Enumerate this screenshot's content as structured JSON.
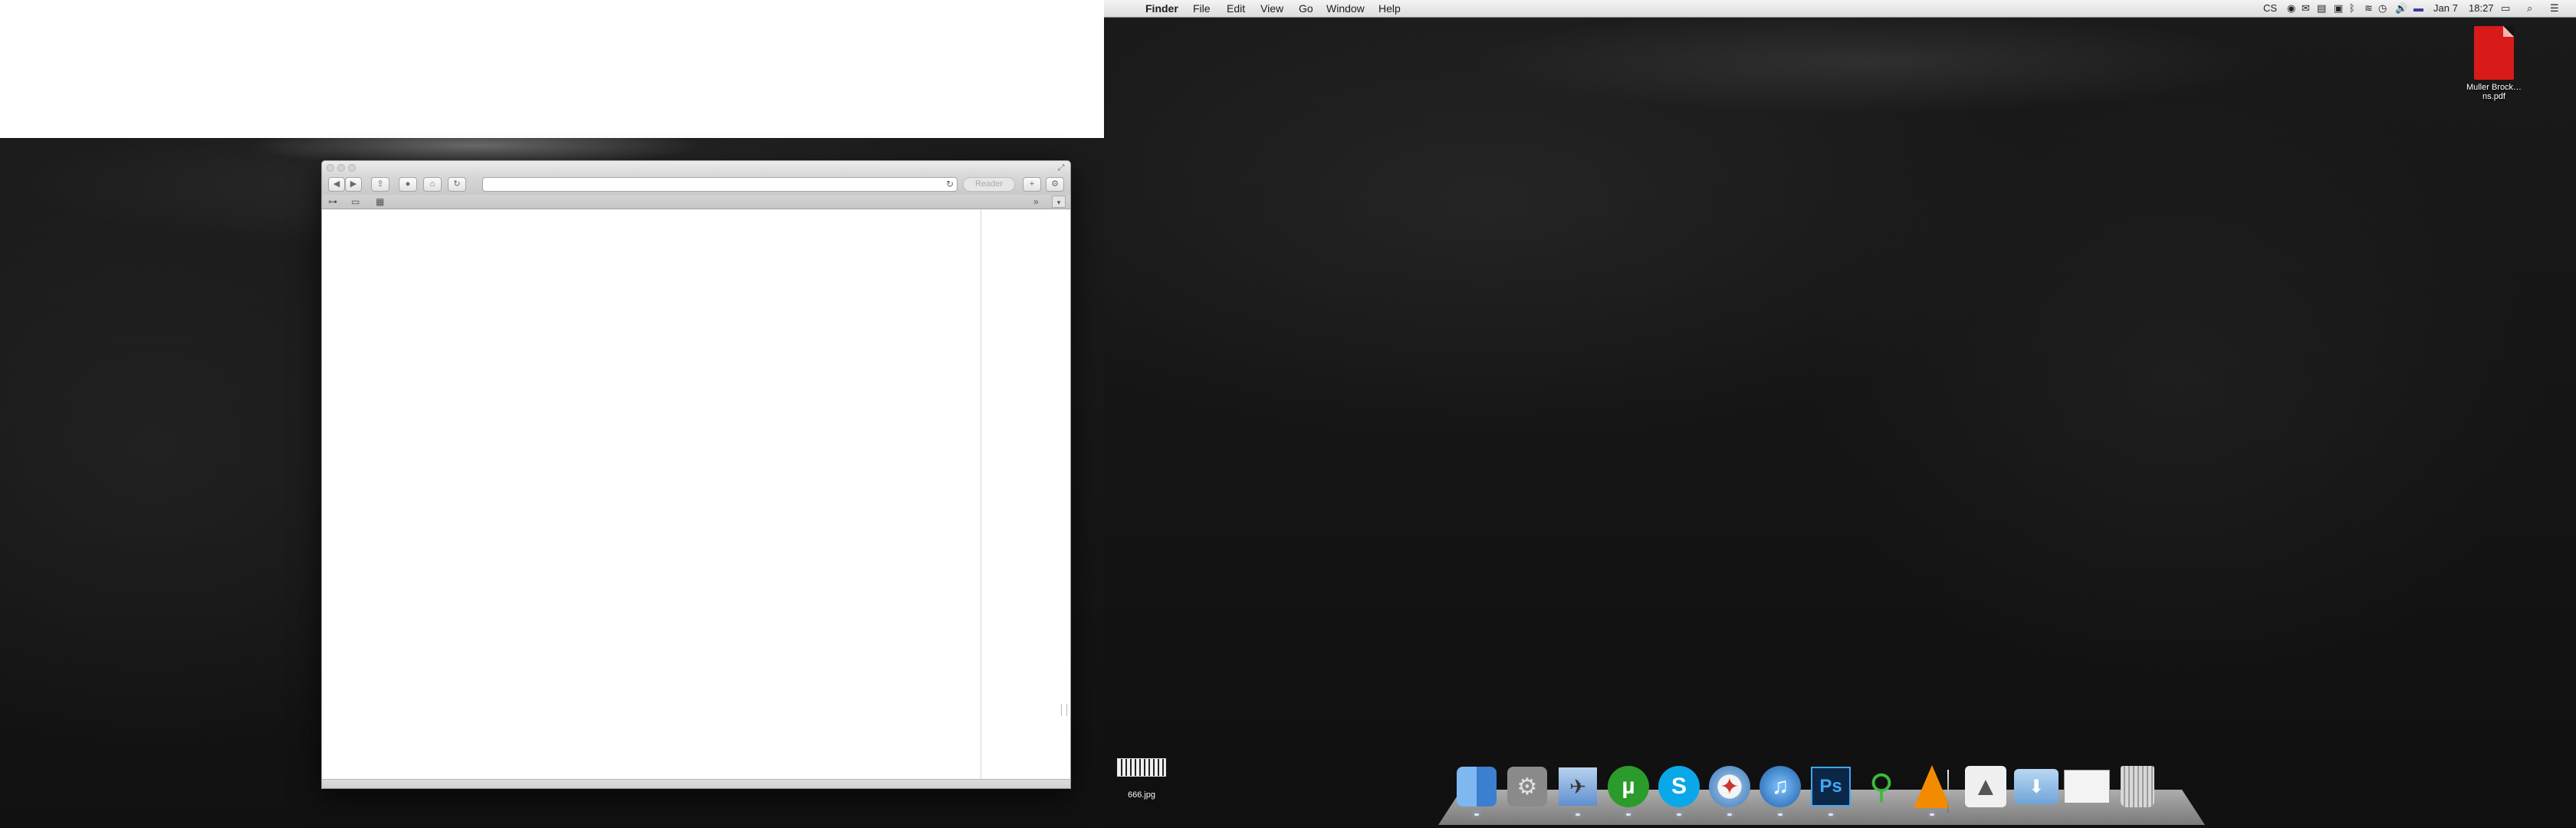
{
  "menubar": {
    "apple_glyph": "",
    "app_name": "Finder",
    "menus": [
      "File",
      "Edit",
      "View",
      "Go",
      "Window",
      "Help"
    ],
    "status": {
      "cs_label": "CS",
      "date": "Jan 7",
      "time": "18:27"
    }
  },
  "browser": {
    "address_value": "",
    "reader_label": "Reader"
  },
  "desktop": {
    "pdf_file_label": "Muller Brock…ns.pdf",
    "jpg_file_label": "666.jpg"
  },
  "dock": {
    "apps": [
      {
        "name": "Finder",
        "icon": "finder-icon"
      },
      {
        "name": "System Preferences",
        "icon": "gear-icon"
      },
      {
        "name": "Mail",
        "icon": "mail-icon"
      },
      {
        "name": "uTorrent",
        "icon": "utorrent-icon"
      },
      {
        "name": "Skype",
        "icon": "skype-icon"
      },
      {
        "name": "Safari",
        "icon": "compass-icon"
      },
      {
        "name": "iTunes",
        "icon": "music-note-icon"
      },
      {
        "name": "Photoshop",
        "icon": "ps-icon",
        "text": "Ps"
      },
      {
        "name": "Alien app",
        "icon": "alien-icon"
      },
      {
        "name": "VLC",
        "icon": "traffic-cone-icon"
      },
      {
        "name": "Applications",
        "icon": "applications-stack-icon"
      },
      {
        "name": "Downloads",
        "icon": "downloads-folder-icon"
      },
      {
        "name": "Documents",
        "icon": "documents-stack-icon"
      },
      {
        "name": "Trash",
        "icon": "trash-icon"
      }
    ],
    "colors": {
      "utorrent": "#2b9b2b",
      "skype": "#0aa8e8",
      "photoshop_bg": "#0b2745",
      "photoshop_text": "#3fa7f5",
      "vlc": "#f28b00",
      "alien": "#3dbb3d"
    }
  }
}
